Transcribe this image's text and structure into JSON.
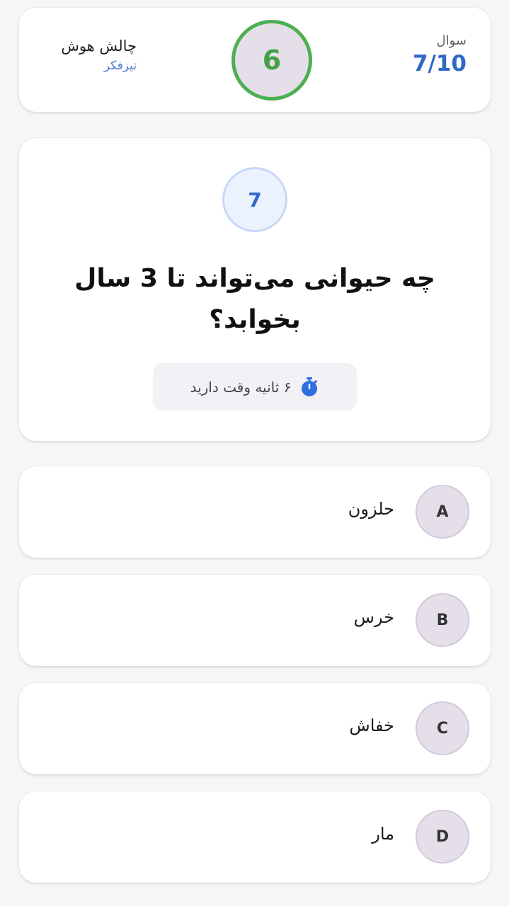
{
  "header": {
    "question_label": "سوال",
    "question_count": "7/10",
    "countdown_value": "6",
    "app_title": "چالش هوش",
    "app_subtitle": "تیزفکر"
  },
  "question": {
    "number": "7",
    "text": "چه حیوانی می‌تواند تا 3 سال بخوابد؟",
    "time_left_text": "۶ ثانیه وقت دارید",
    "timer_icon": "stopwatch-icon"
  },
  "options": [
    {
      "letter": "A",
      "text": "حلزون"
    },
    {
      "letter": "B",
      "text": "خرس"
    },
    {
      "letter": "C",
      "text": "خفاش"
    },
    {
      "letter": "D",
      "text": "مار"
    }
  ],
  "colors": {
    "accent_blue": "#3169c6",
    "timer_green": "#4caf50",
    "option_circle_bg": "#e5dfea",
    "stopwatch_blue": "#2f6fe0"
  }
}
